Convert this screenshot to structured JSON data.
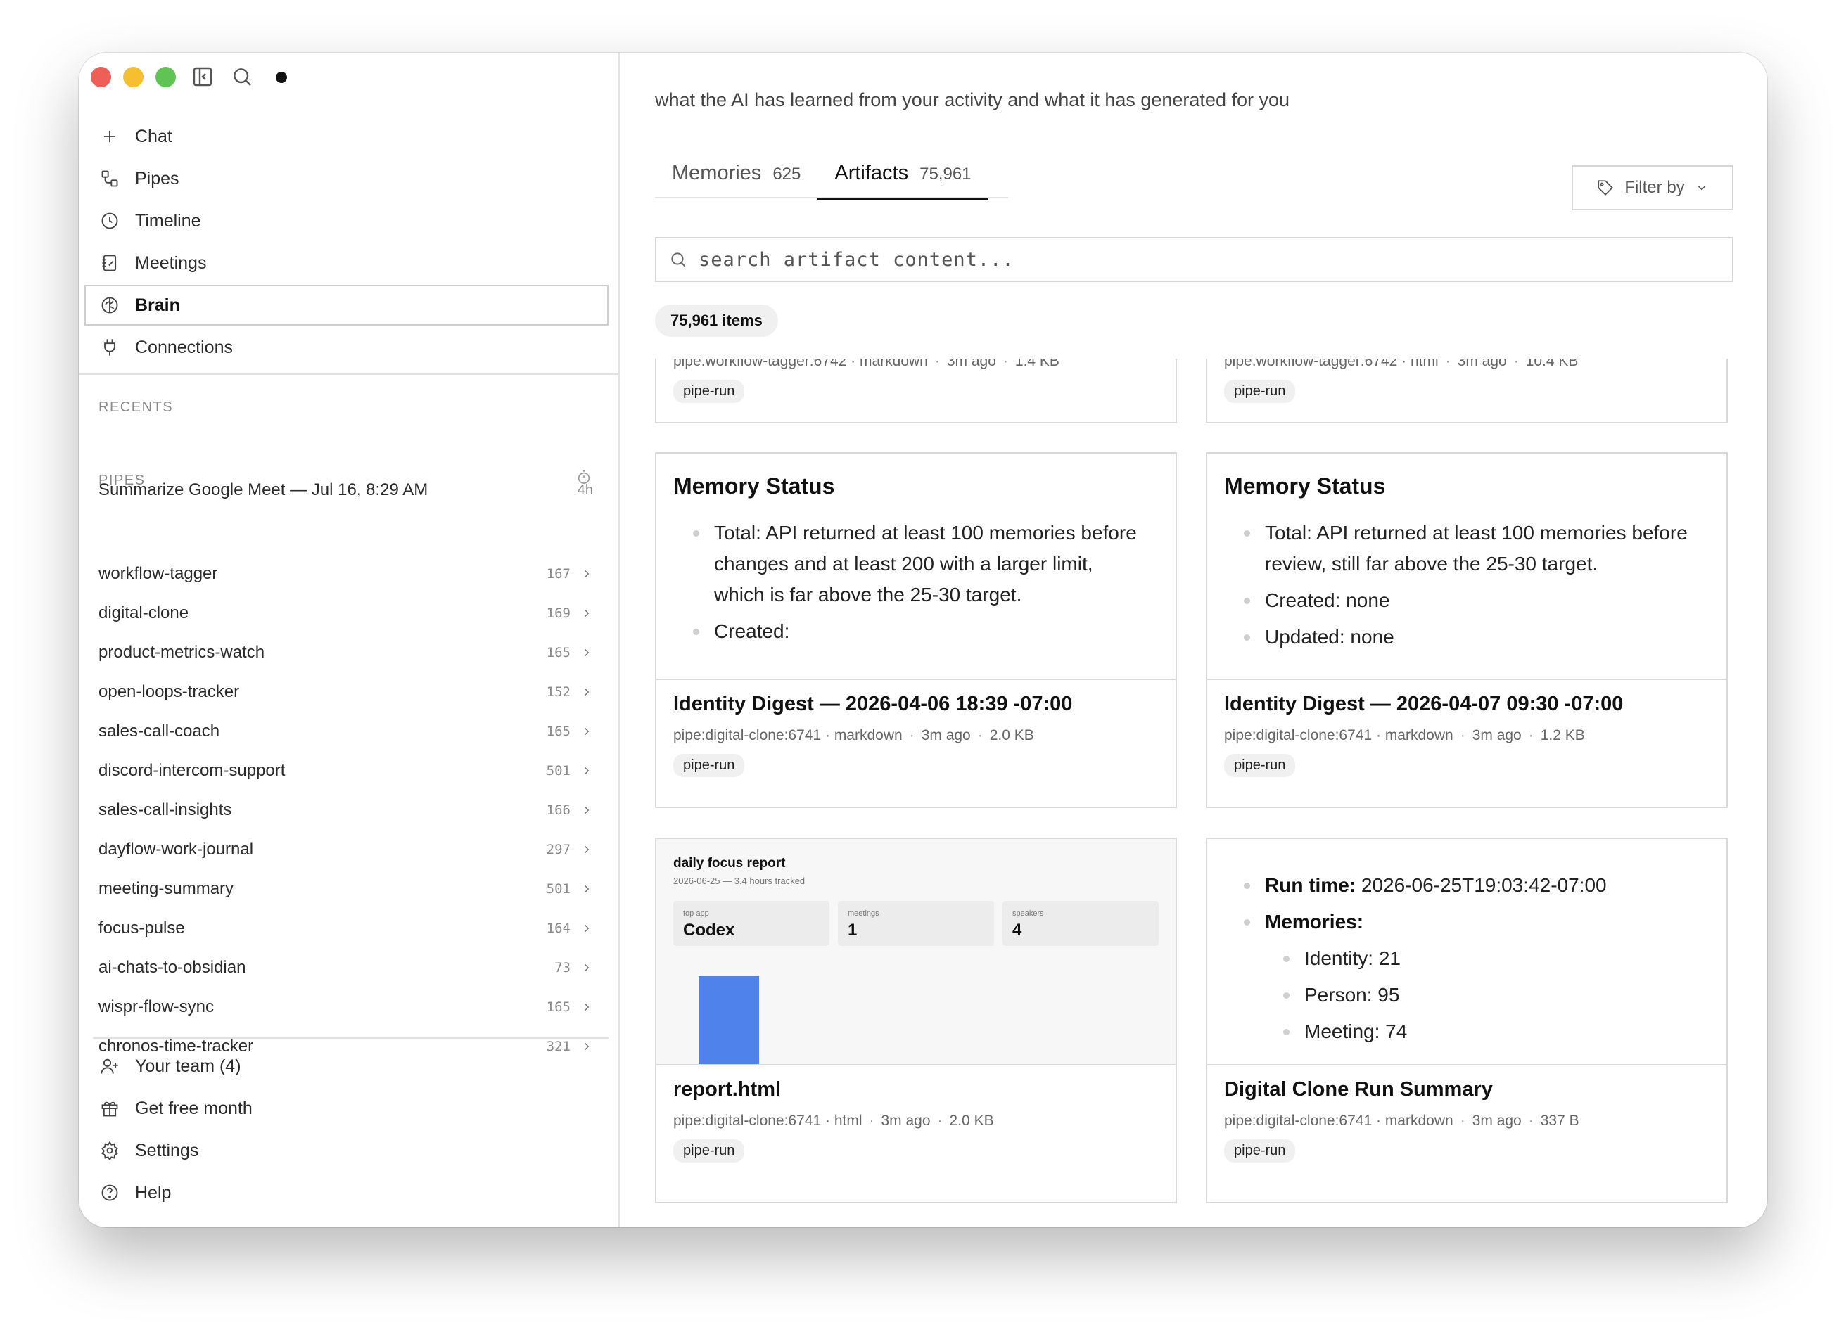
{
  "sidebar": {
    "nav": [
      {
        "label": "Chat",
        "icon": "plus-icon"
      },
      {
        "label": "Pipes",
        "icon": "pipes-icon"
      },
      {
        "label": "Timeline",
        "icon": "clock-icon"
      },
      {
        "label": "Meetings",
        "icon": "notebook-icon"
      },
      {
        "label": "Brain",
        "icon": "brain-icon",
        "active": true
      },
      {
        "label": "Connections",
        "icon": "plug-icon"
      }
    ],
    "recents_title": "RECENTS",
    "recent": {
      "label": "Summarize Google Meet — Jul 16, 8:29 AM",
      "time": "4h"
    },
    "pipes_title": "PIPES",
    "pipes": [
      {
        "name": "workflow-tagger",
        "count": "167"
      },
      {
        "name": "digital-clone",
        "count": "169"
      },
      {
        "name": "product-metrics-watch",
        "count": "165"
      },
      {
        "name": "open-loops-tracker",
        "count": "152"
      },
      {
        "name": "sales-call-coach",
        "count": "165"
      },
      {
        "name": "discord-intercom-support",
        "count": "501"
      },
      {
        "name": "sales-call-insights",
        "count": "166"
      },
      {
        "name": "dayflow-work-journal",
        "count": "297"
      },
      {
        "name": "meeting-summary",
        "count": "501"
      },
      {
        "name": "focus-pulse",
        "count": "164"
      },
      {
        "name": "ai-chats-to-obsidian",
        "count": "73"
      },
      {
        "name": "wispr-flow-sync",
        "count": "165"
      },
      {
        "name": "chronos-time-tracker",
        "count": "321"
      }
    ],
    "bottom": [
      {
        "label": "Your team (4)",
        "icon": "user-plus-icon"
      },
      {
        "label": "Get free month",
        "icon": "gift-icon"
      },
      {
        "label": "Settings",
        "icon": "gear-icon"
      },
      {
        "label": "Help",
        "icon": "help-icon"
      }
    ]
  },
  "main": {
    "subtitle": "what the AI has learned from your activity and what it has generated for you",
    "tabs": [
      {
        "label": "Memories",
        "count": "625"
      },
      {
        "label": "Artifacts",
        "count": "75,961",
        "active": true
      }
    ],
    "filter_label": "Filter by",
    "search_placeholder": "search artifact content...",
    "items_count": "75,961 items"
  },
  "cards": [
    {
      "meta": [
        "pipe:workflow-tagger:6742 · markdown",
        "3m ago",
        "1.4 KB"
      ],
      "tag": "pipe-run"
    },
    {
      "meta": [
        "pipe:workflow-tagger:6742 · html",
        "3m ago",
        "10.4 KB"
      ],
      "tag": "pipe-run"
    },
    {
      "preview_title": "Memory Status",
      "preview_items": [
        "Total: API returned at least 100 memories before changes and at least 200 with a larger limit, which is far above the 25-30 target.",
        "Created:"
      ],
      "title": "Identity Digest — 2026-04-06 18:39 -07:00",
      "meta": [
        "pipe:digital-clone:6741 · markdown",
        "3m ago",
        "2.0 KB"
      ],
      "tag": "pipe-run"
    },
    {
      "preview_title": "Memory Status",
      "preview_items": [
        "Total: API returned at least 100 memories before review, still far above the 25-30 target.",
        "Created: none",
        "Updated: none"
      ],
      "title": "Identity Digest — 2026-04-07 09:30 -07:00",
      "meta": [
        "pipe:digital-clone:6741 · markdown",
        "3m ago",
        "1.2 KB"
      ],
      "tag": "pipe-run"
    },
    {
      "report": {
        "title": "daily focus report",
        "subtitle": "2026-06-25 — 3.4 hours tracked",
        "stats": [
          {
            "label": "top app",
            "value": "Codex"
          },
          {
            "label": "meetings",
            "value": "1"
          },
          {
            "label": "speakers",
            "value": "4"
          }
        ],
        "bar_color": "#4f82ea"
      },
      "title": "report.html",
      "meta": [
        "pipe:digital-clone:6741 · html",
        "3m ago",
        "2.0 KB"
      ],
      "tag": "pipe-run"
    },
    {
      "run_time_label": "Run time:",
      "run_time_value": "2026-06-25T19:03:42-07:00",
      "memories_label": "Memories:",
      "memories": [
        "Identity: 21",
        "Person: 95",
        "Meeting: 74"
      ],
      "title": "Digital Clone Run Summary",
      "meta": [
        "pipe:digital-clone:6741 · markdown",
        "3m ago",
        "337 B"
      ],
      "tag": "pipe-run"
    }
  ],
  "colors": {
    "accent": "#111111",
    "bar_blue": "#4f82ea",
    "traffic_red": "#ee5f57",
    "traffic_yellow": "#f5bf30",
    "traffic_green": "#5fc453"
  }
}
